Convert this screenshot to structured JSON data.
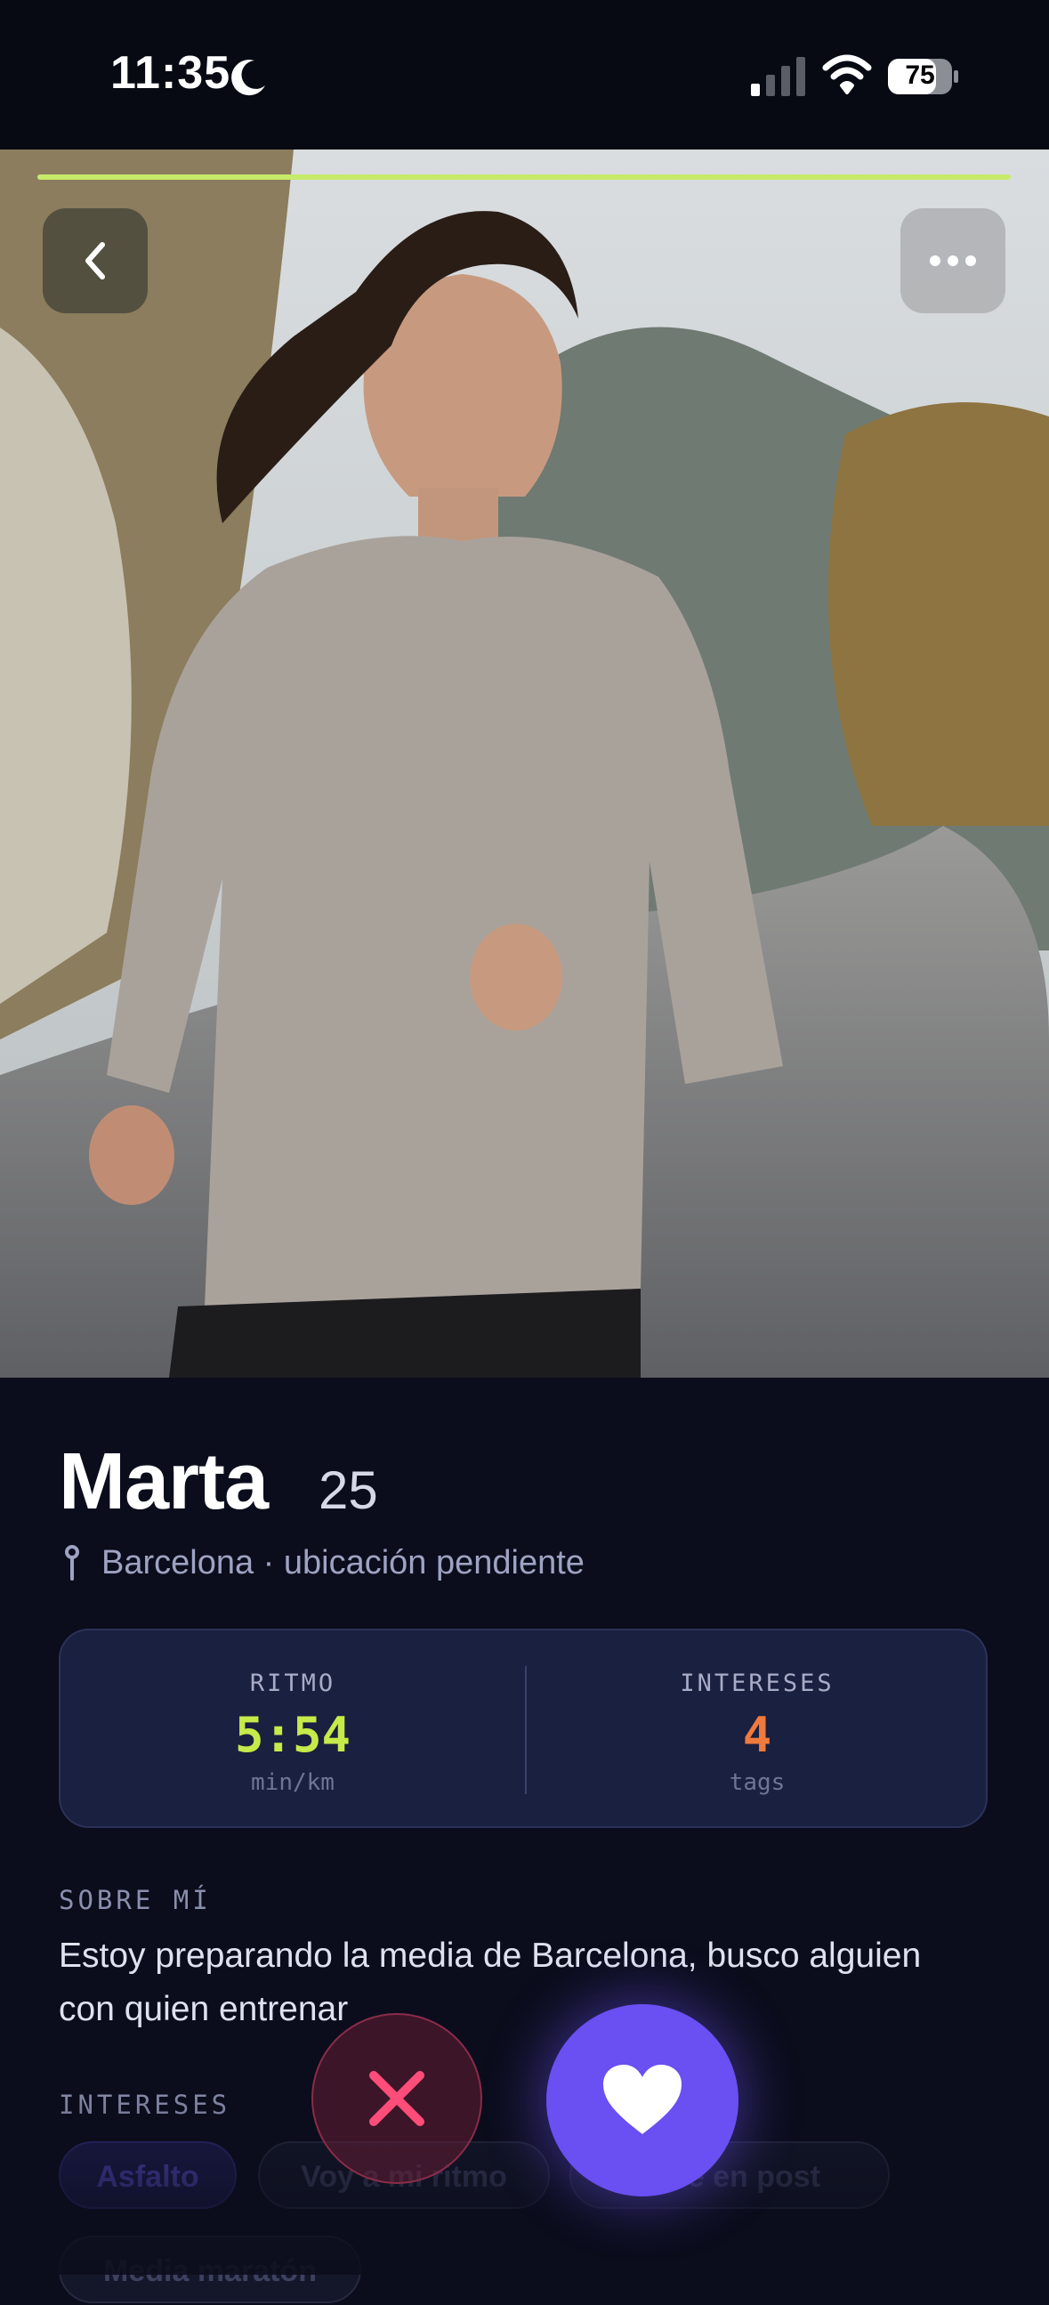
{
  "status_bar": {
    "time": "11:35",
    "battery": "75",
    "icons": [
      "moon-icon",
      "cellular-signal-icon",
      "wifi-icon",
      "battery-icon"
    ]
  },
  "photo": {
    "progress": 1.0,
    "progress_color": "#c6ea6a",
    "icons": [
      "chevron-left-icon",
      "more-horizontal-icon"
    ]
  },
  "profile": {
    "name": "Marta",
    "age": "25",
    "location": "Barcelona · ubicación pendiente",
    "location_icon": "pin-icon"
  },
  "stats": [
    {
      "label": "RITMO",
      "value": "5:54",
      "unit": "min/km",
      "color": "#c6ea4a"
    },
    {
      "label": "INTERESES",
      "value": "4",
      "unit": "tags",
      "color": "#f07a3c"
    }
  ],
  "about": {
    "title": "SOBRE MÍ",
    "text": "Estoy preparando la media de Barcelona, busco alguien con quien entrenar"
  },
  "interests": {
    "title": "INTERESES",
    "chips": [
      "Asfalto",
      "Voy a mi ritmo",
      "Café en post",
      "Media maratón"
    ]
  },
  "actions": {
    "pass_icon": "close-icon",
    "like_icon": "heart-icon",
    "like_color": "#6a4ff2",
    "pass_color": "#ff4d7a"
  }
}
